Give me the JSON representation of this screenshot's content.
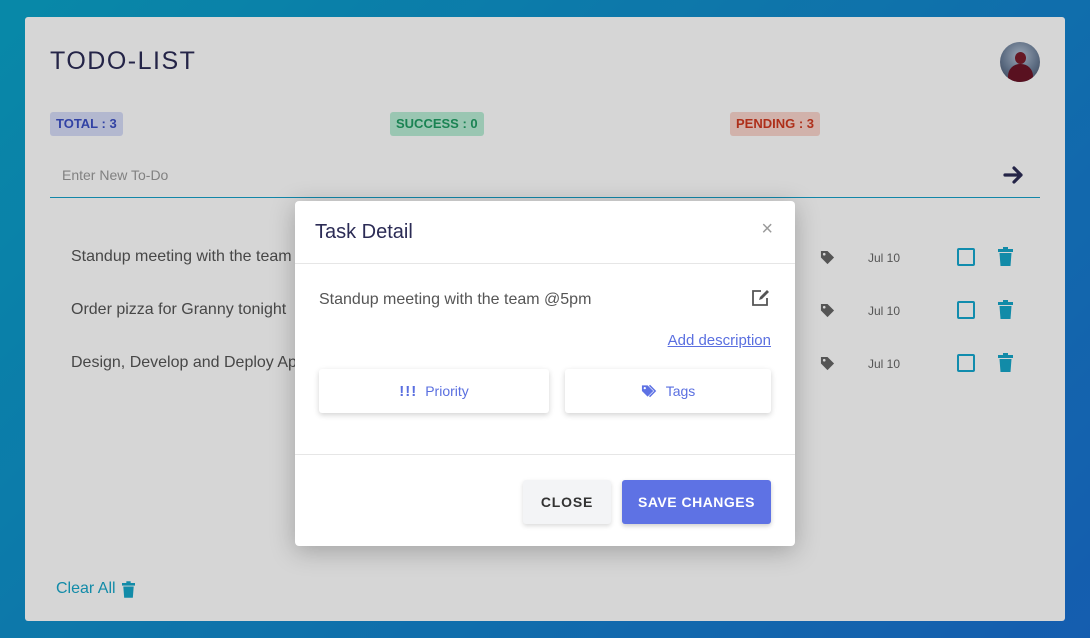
{
  "app": {
    "title": "TODO-LIST"
  },
  "stats": {
    "total": "TOTAL : 3",
    "success": "SUCCESS : 0",
    "pending": "PENDING : 3"
  },
  "new_todo": {
    "placeholder": "Enter New To-Do",
    "value": ""
  },
  "todos": [
    {
      "text": "Standup meeting with the team @5pm",
      "date": "Jul 10",
      "done": false
    },
    {
      "text": "Order pizza for Granny tonight",
      "date": "Jul 10",
      "done": false
    },
    {
      "text": "Design, Develop and Deploy Apps",
      "date": "Jul 10",
      "done": false
    }
  ],
  "footer": {
    "clear_all": "Clear All"
  },
  "modal": {
    "title": "Task Detail",
    "close_symbol": "×",
    "task_text": "Standup meeting with the team @5pm",
    "add_description": "Add description",
    "priority_marks": "!!!",
    "priority_label": "Priority",
    "tags_label": "Tags",
    "close_button": "CLOSE",
    "save_button": "SAVE CHANGES"
  },
  "colors": {
    "accent": "#16a6c9",
    "primary": "#5e72e4",
    "success": "#1f9d63",
    "pending": "#d0391f",
    "total": "#3b4fc4"
  },
  "icons": {
    "submit": "arrow-right-icon",
    "tag": "tag-icon",
    "checkbox": "checkbox-icon",
    "trash": "trash-icon",
    "edit": "edit-icon",
    "tags": "tags-icon",
    "avatar": "user-avatar"
  }
}
